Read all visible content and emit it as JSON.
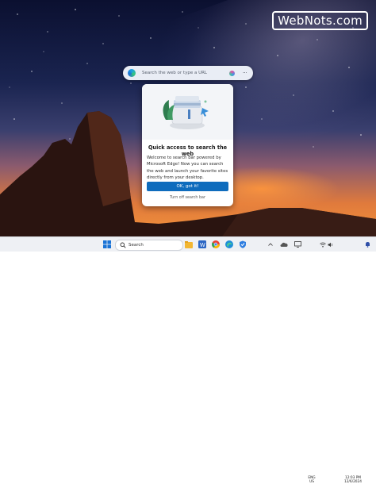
{
  "watermark": "WebNots.com",
  "search_bar": {
    "placeholder": "Search the web or type a URL",
    "more_label": "···"
  },
  "card": {
    "title": "Quick access to search the web",
    "body": "Welcome to search bar powered by Microsoft Edge! Now you can search the web and launch your favorite sites directly from your desktop.",
    "ok_button": "OK, got it!",
    "turn_off_link": "Turn off search bar"
  },
  "taskbar": {
    "search_label": "Search",
    "language_line1": "ENG",
    "language_line2": "US",
    "time": "12:03 PM",
    "date": "12/6/2024",
    "apps": [
      "file-explorer-icon",
      "word-icon",
      "chrome-icon",
      "edge-icon",
      "shield-icon"
    ]
  },
  "colors": {
    "accent_button": "#0f6cbd",
    "taskbar_bg": "#eef0f4"
  }
}
